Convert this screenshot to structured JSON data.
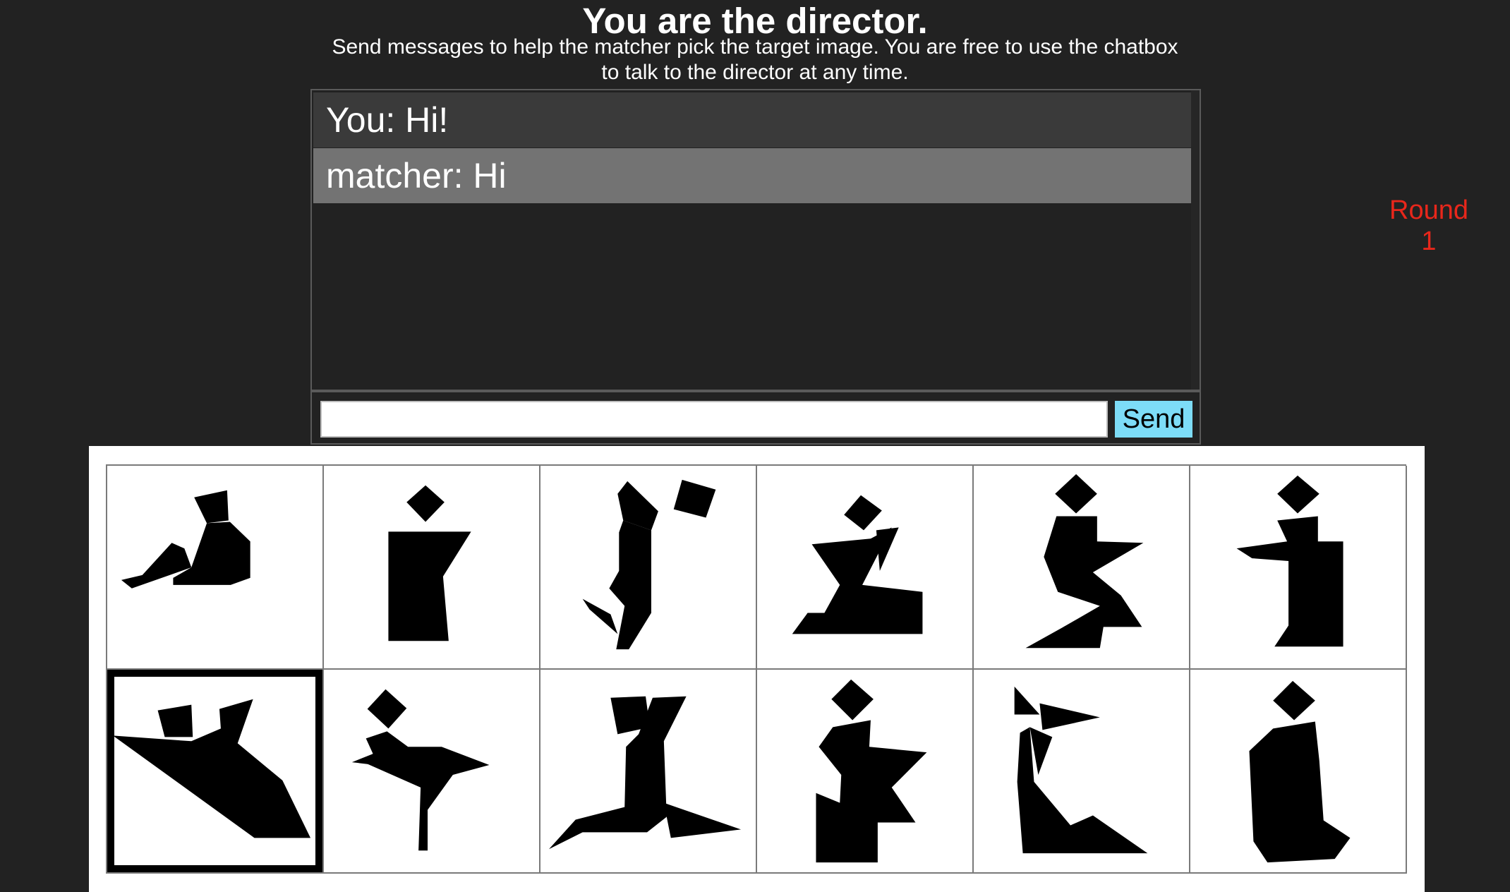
{
  "header": {
    "title": "You are the director.",
    "subtitle_line1": "Send messages to help the matcher pick the target image. You are free to use the chatbox",
    "subtitle_line2": "to talk to the director at any time."
  },
  "chat": {
    "messages": [
      {
        "text": "You: Hi!"
      },
      {
        "text": "matcher: Hi"
      }
    ],
    "input_value": "",
    "input_placeholder": "",
    "send_label": "Send"
  },
  "round": {
    "label": "Round",
    "number": "1"
  },
  "colors": {
    "background": "#222222",
    "send_button": "#7ddcf7",
    "round_text": "#e8271b",
    "own_message_row": "#3a3a3a",
    "partner_message_row": "#737373"
  },
  "board": {
    "rows": 2,
    "columns": 6,
    "target_index": 6,
    "tangrams": [
      {
        "icon": "tangram-reclining-figure-icon"
      },
      {
        "icon": "tangram-standing-block-figure-icon"
      },
      {
        "icon": "tangram-dancing-figure-icon"
      },
      {
        "icon": "tangram-kneeling-figure-icon"
      },
      {
        "icon": "tangram-zigzag-figure-icon"
      },
      {
        "icon": "tangram-robed-figure-icon"
      },
      {
        "icon": "tangram-swimmer-figure-icon"
      },
      {
        "icon": "tangram-kicking-figure-icon"
      },
      {
        "icon": "tangram-sliding-figure-icon"
      },
      {
        "icon": "tangram-seated-figure-icon"
      },
      {
        "icon": "tangram-bow-figure-icon"
      },
      {
        "icon": "tangram-rounded-figure-icon"
      }
    ]
  }
}
